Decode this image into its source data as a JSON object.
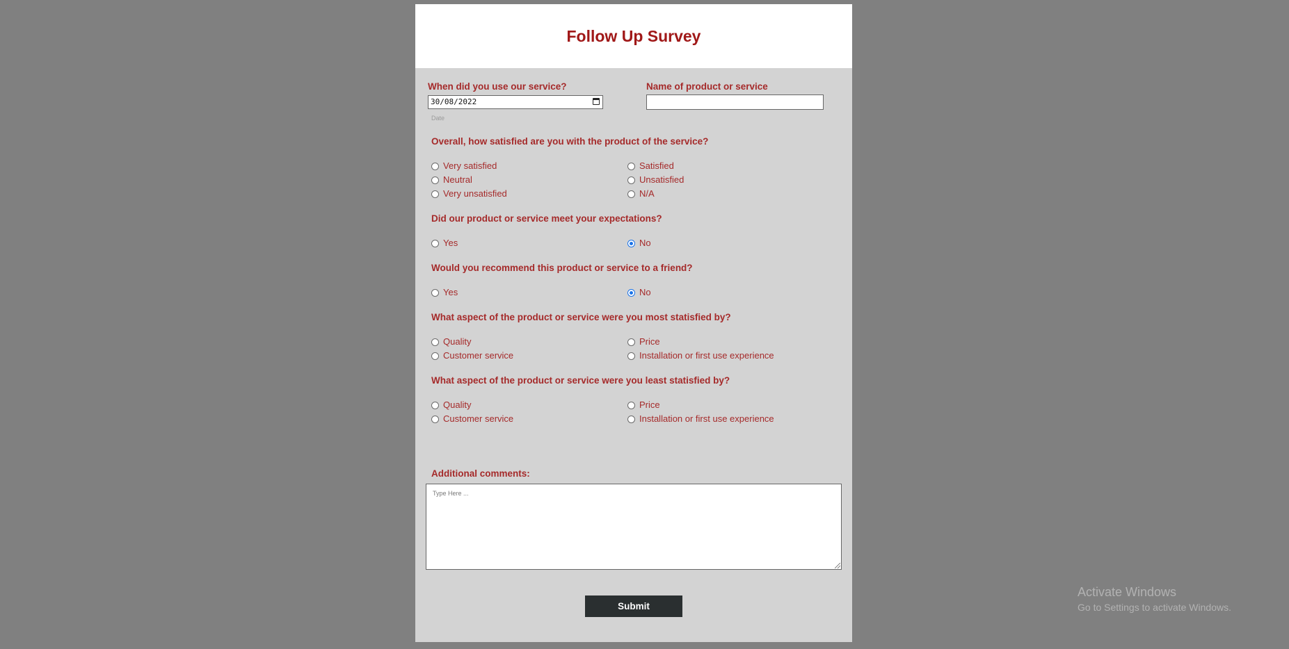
{
  "form": {
    "title": "Follow Up Survey",
    "date_question": "When did you use our service?",
    "date_value": "30/08/2022",
    "date_sublabel": "Date",
    "product_question": "Name of product or service",
    "product_value": "",
    "satisfaction": {
      "question": "Overall, how satisfied are you with the product of the service?",
      "options": [
        "Very satisfied",
        "Satisfied",
        "Neutral",
        "Unsatisfied",
        "Very unsatisfied",
        "N/A"
      ],
      "selected": null
    },
    "expectations": {
      "question": "Did our product or service meet your expectations?",
      "options": [
        "Yes",
        "No"
      ],
      "selected": "No"
    },
    "recommend": {
      "question": "Would you recommend this product or service to a friend?",
      "options": [
        "Yes",
        "No"
      ],
      "selected": "No"
    },
    "most_satisfied": {
      "question": "What aspect of the product or service were you most statisfied by?",
      "options": [
        "Quality",
        "Price",
        "Customer service",
        "Installation or first use experience"
      ],
      "selected": null
    },
    "least_satisfied": {
      "question": "What aspect of the product or service were you least statisfied by?",
      "options": [
        "Quality",
        "Price",
        "Customer service",
        "Installation or first use experience"
      ],
      "selected": null
    },
    "comments_label": "Additional comments:",
    "comments_placeholder": "Type Here ...",
    "comments_value": "",
    "submit_label": "Submit"
  },
  "os_watermark": {
    "title": "Activate Windows",
    "subtitle": "Go to Settings to activate Windows."
  },
  "colors": {
    "background": "#808080",
    "card": "#d3d3d3",
    "header": "#ffffff",
    "title": "#a01818",
    "label": "#a52a2a",
    "submit_bg": "#2a2f30",
    "radio_checked": "#1a73e8"
  }
}
